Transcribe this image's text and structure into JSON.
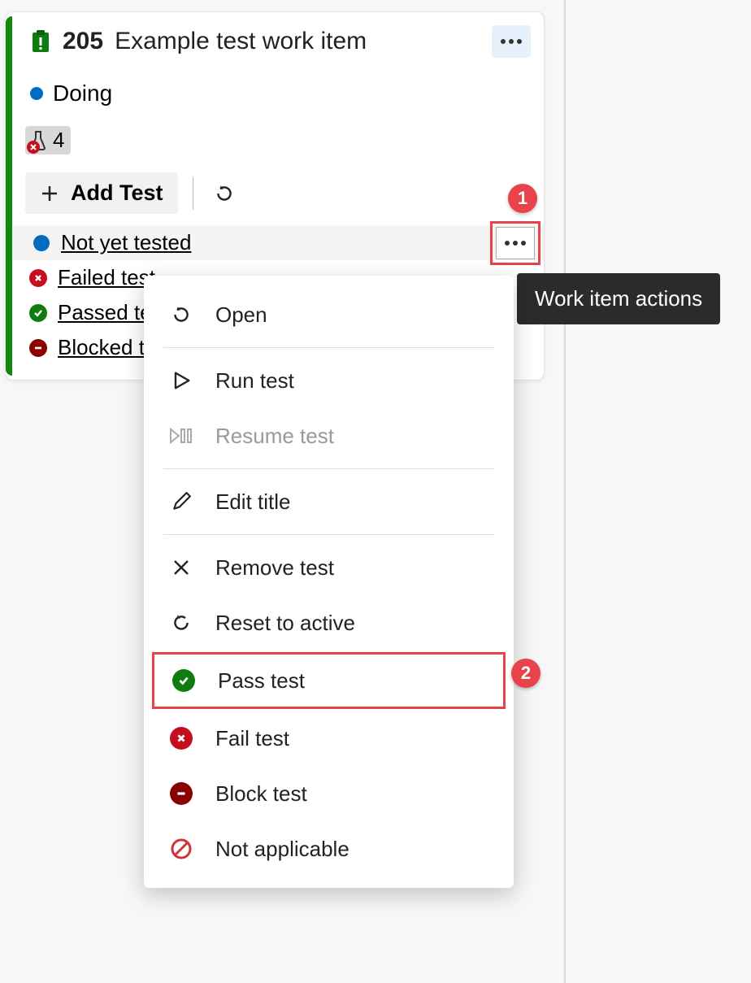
{
  "card": {
    "id": "205",
    "title": "Example test work item",
    "state": "Doing",
    "test_count": "4",
    "add_test_label": "Add Test"
  },
  "tests": [
    {
      "status": "active",
      "label": "Not yet tested"
    },
    {
      "status": "failed",
      "label": "Failed test"
    },
    {
      "status": "passed",
      "label": "Passed test"
    },
    {
      "status": "blocked",
      "label": "Blocked test"
    }
  ],
  "tooltip": "Work item actions",
  "callouts": {
    "one": "1",
    "two": "2"
  },
  "menu": {
    "open": "Open",
    "run": "Run test",
    "resume": "Resume test",
    "edit": "Edit title",
    "remove": "Remove test",
    "reset": "Reset to active",
    "pass": "Pass test",
    "fail": "Fail test",
    "block": "Block test",
    "na": "Not applicable"
  }
}
